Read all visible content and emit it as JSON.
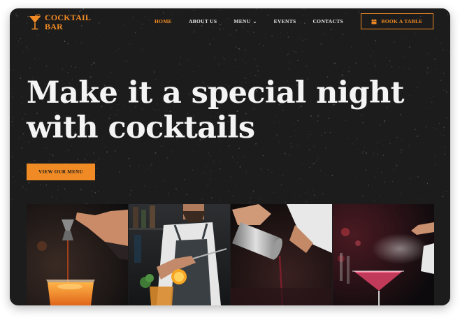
{
  "brand": {
    "line1": "COCKTAIL",
    "line2": "BAR",
    "icon": "cocktail-glass-icon",
    "accent_color": "#f08a24"
  },
  "nav": {
    "items": [
      {
        "label": "HOME",
        "active": true
      },
      {
        "label": "ABOUT US",
        "active": false
      },
      {
        "label": "MENU",
        "active": false,
        "dropdown_icon": "chevron-down-icon"
      },
      {
        "label": "EVENTS",
        "active": false
      },
      {
        "label": "CONTACTS",
        "active": false
      }
    ],
    "cta": {
      "label": "BOOK A TABLE",
      "icon": "calendar-icon"
    }
  },
  "hero": {
    "title_line1": "Make it a special night",
    "title_line2": "with cocktails",
    "button_label": "VIEW OUR MENU",
    "background_color": "#1c1c1c"
  },
  "gallery": {
    "images": [
      {
        "description": "Bartender pouring from a jigger into an orange cocktail glass"
      },
      {
        "description": "Bartender in apron garnishing a drink with an orange slice"
      },
      {
        "description": "Bartender pouring from a cocktail shaker"
      },
      {
        "description": "Spraying a mist over a pink martini cocktail"
      }
    ]
  }
}
